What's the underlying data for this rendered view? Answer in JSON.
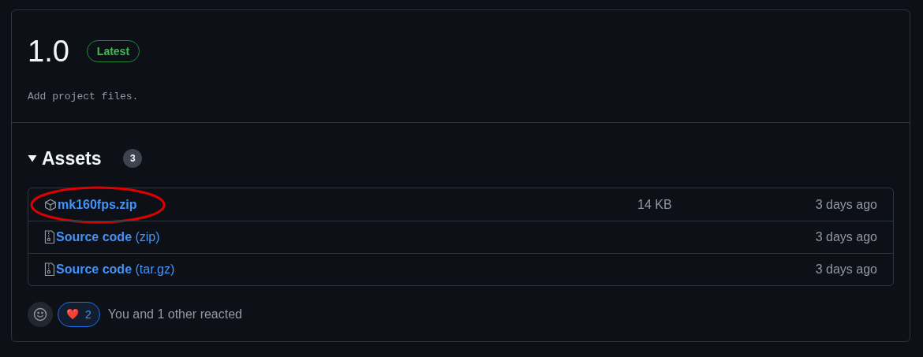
{
  "release": {
    "title": "1.0",
    "badge": "Latest",
    "notes": "Add project files."
  },
  "assets": {
    "heading": "Assets",
    "count": "3",
    "expanded": true,
    "items": [
      {
        "kind": "package",
        "name": "mk160fps.zip",
        "size": "14 KB",
        "date": "3 days ago",
        "circled": true
      },
      {
        "kind": "source",
        "name": "**Source code** (zip)",
        "date": "3 days ago",
        "circled": false
      },
      {
        "kind": "source",
        "name": "**Source code** (tar.gz)",
        "date": "3 days ago",
        "circled": false
      }
    ]
  },
  "reactions": {
    "items": [
      {
        "emoji": "❤️",
        "count": "2",
        "selected": true
      }
    ],
    "summary": "You and 1 other reacted"
  }
}
